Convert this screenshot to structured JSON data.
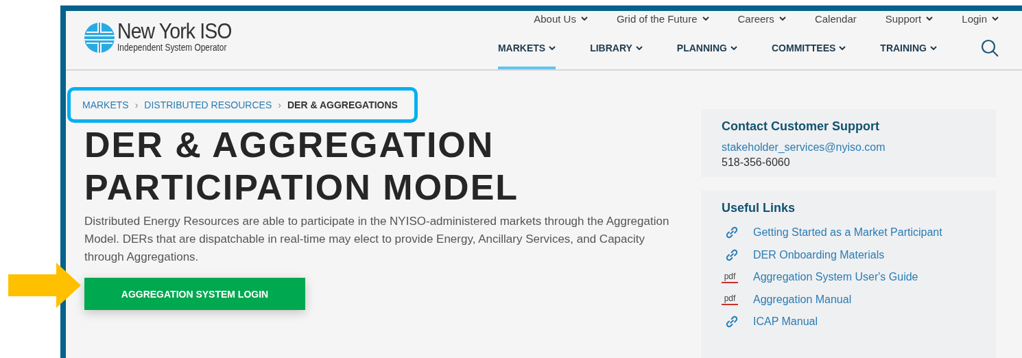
{
  "logo": {
    "name": "New York ISO",
    "tagline": "Independent System Operator"
  },
  "top_nav": [
    {
      "label": "About Us",
      "dropdown": true
    },
    {
      "label": "Grid of the Future",
      "dropdown": true
    },
    {
      "label": "Careers",
      "dropdown": true
    },
    {
      "label": "Calendar",
      "dropdown": false
    },
    {
      "label": "Support",
      "dropdown": true
    },
    {
      "label": "Login",
      "dropdown": true
    }
  ],
  "main_nav": [
    {
      "label": "MARKETS",
      "selected": true
    },
    {
      "label": "LIBRARY",
      "selected": false
    },
    {
      "label": "PLANNING",
      "selected": false
    },
    {
      "label": "COMMITTEES",
      "selected": false
    },
    {
      "label": "TRAINING",
      "selected": false
    }
  ],
  "breadcrumb": [
    {
      "label": "MARKETS",
      "current": false
    },
    {
      "label": "DISTRIBUTED RESOURCES",
      "current": false
    },
    {
      "label": "DER & AGGREGATIONS",
      "current": true
    }
  ],
  "separator": "›",
  "title": "DER & AGGREGATION PARTICIPATION MODEL",
  "description": "Distributed Energy Resources are able to participate in the NYISO-administered markets through the Aggregation Model. DERs that are dispatchable in real-time may elect to provide Energy, Ancillary Services, and Capacity through Aggregations.",
  "login_button": "AGGREGATION SYSTEM LOGIN",
  "contact": {
    "title": "Contact Customer Support",
    "email": "stakeholder_services@nyiso.com",
    "phone": "518-356-6060"
  },
  "useful_links": {
    "title": "Useful Links",
    "items": [
      {
        "label": "Getting Started as a Market Participant",
        "kind": "link"
      },
      {
        "label": "DER Onboarding Materials",
        "kind": "link"
      },
      {
        "label": "Aggregation System User's Guide",
        "kind": "pdf",
        "badge": "pdf"
      },
      {
        "label": "Aggregation Manual",
        "kind": "pdf",
        "badge": "pdf"
      },
      {
        "label": "ICAP Manual",
        "kind": "link"
      }
    ]
  }
}
